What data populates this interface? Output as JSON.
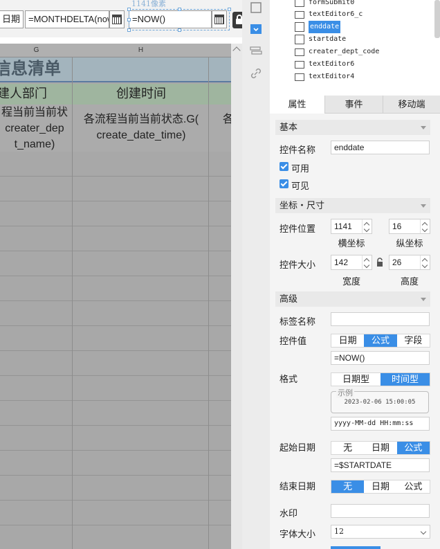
{
  "canvas": {
    "date_label": "日期",
    "monthdelta_formula": "=MONTHDELTA(now",
    "now_formula": "=NOW()",
    "selection_size_label": "1141像素",
    "column_headers": [
      "G",
      "H"
    ],
    "title_text": "信息清单",
    "header_cells": [
      "建人部门",
      "创建时间"
    ],
    "sub_cells": {
      "g_lines": [
        "程当前当前状",
        "creater_dep",
        "t_name)"
      ],
      "h_lines": [
        "各流程当前当前状态.G(",
        "create_date_time)"
      ],
      "i_partial": "各"
    }
  },
  "tree": {
    "items": [
      {
        "label": "formSubmit0",
        "icon": "form-submit-icon"
      },
      {
        "label": "textEditor6_c",
        "icon": "text-field-icon"
      },
      {
        "label": "enddate",
        "icon": "calendar-icon",
        "selected": true
      },
      {
        "label": "startdate",
        "icon": "calendar-icon"
      },
      {
        "label": "creater_dept_code",
        "icon": "dropdown-icon"
      },
      {
        "label": "textEditor6",
        "icon": "text-field-icon"
      },
      {
        "label": "textEditor4",
        "icon": "text-field-icon"
      }
    ]
  },
  "props": {
    "tabs": [
      "属性",
      "事件",
      "移动端"
    ],
    "active_tab": 0,
    "basic": {
      "section_label": "基本",
      "name_label": "控件名称",
      "name_value": "enddate",
      "enabled_label": "可用",
      "visible_label": "可见"
    },
    "coords": {
      "section_label": "坐标・尺寸",
      "position_label": "控件位置",
      "x_value": "1141",
      "x_caption": "横坐标",
      "y_value": "16",
      "y_caption": "纵坐标",
      "size_label": "控件大小",
      "w_value": "142",
      "w_caption": "宽度",
      "h_value": "26",
      "h_caption": "高度"
    },
    "advanced": {
      "section_label": "高级",
      "tag_label": "标签名称",
      "tag_value": "",
      "value_label": "控件值",
      "value_modes": [
        "日期",
        "公式",
        "字段"
      ],
      "value_formula": "=NOW()",
      "format_label": "格式",
      "format_modes": [
        "日期型",
        "时间型"
      ],
      "example_caption": "示例",
      "example_value": "2023-02-06 15:00:05",
      "format_pattern": "yyyy-MM-dd HH:mm:ss",
      "start_label": "起始日期",
      "start_modes": [
        "无",
        "日期",
        "公式"
      ],
      "start_formula": "=$STARTDATE",
      "end_label": "结束日期",
      "end_modes": [
        "无",
        "日期",
        "公式"
      ],
      "watermark_label": "水印",
      "watermark_value": "",
      "font_size_label": "字体大小",
      "font_size_value": "12"
    }
  }
}
